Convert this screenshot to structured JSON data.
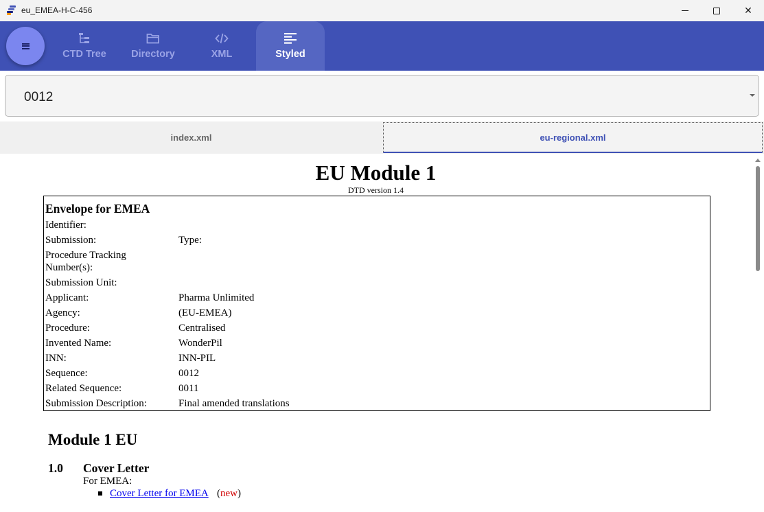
{
  "window": {
    "title": "eu_EMEA-H-C-456",
    "minimize_icon": "minimize-icon",
    "maximize_icon": "maximize-icon",
    "close_glyph": "✕"
  },
  "toolbar": {
    "menu_icon": "hamburger-menu-icon",
    "accent_color": "#3f51b5",
    "tabs": [
      {
        "label": "CTD Tree",
        "icon": "tree-icon",
        "active": false
      },
      {
        "label": "Directory",
        "icon": "folder-icon",
        "active": false
      },
      {
        "label": "XML",
        "icon": "code-icon",
        "active": false
      },
      {
        "label": "Styled",
        "icon": "styled-text-icon",
        "active": true
      }
    ]
  },
  "sequence_select": {
    "value": "0012",
    "icon": "dropdown-caret-icon"
  },
  "file_tabs": [
    {
      "label": "index.xml",
      "active": false
    },
    {
      "label": "eu-regional.xml",
      "active": true
    }
  ],
  "document": {
    "title": "EU Module 1",
    "dtd_version": "DTD version 1.4",
    "envelope": {
      "heading": "Envelope for EMEA",
      "rows": {
        "identifier": {
          "label": "Identifier:",
          "value": ""
        },
        "submission": {
          "label": "Submission:",
          "value": "Type:"
        },
        "procedure_tracking": {
          "label": "Procedure Tracking Number(s):",
          "value": ""
        },
        "submission_unit": {
          "label": "Submission Unit:",
          "value": ""
        },
        "applicant": {
          "label": "Applicant:",
          "value": "Pharma Unlimited"
        },
        "agency": {
          "label": "Agency:",
          "value": "(EU-EMEA)"
        },
        "procedure": {
          "label": "Procedure:",
          "value": "Centralised"
        },
        "invented_name": {
          "label": "Invented Name:",
          "value": "WonderPil"
        },
        "inn": {
          "label": "INN:",
          "value": "INN-PIL"
        },
        "sequence": {
          "label": "Sequence:",
          "value": "0012"
        },
        "related_sequence": {
          "label": "Related Sequence:",
          "value": "0011"
        },
        "submission_description": {
          "label": "Submission Description:",
          "value": "Final amended translations"
        }
      }
    },
    "module_heading": "Module 1 EU",
    "section": {
      "number": "1.0",
      "title": "Cover Letter",
      "intro": "For EMEA:",
      "link_text": "Cover Letter for EMEA",
      "paren_open": "(",
      "status": "new",
      "paren_close": ")",
      "status_color": "#d00000"
    }
  }
}
